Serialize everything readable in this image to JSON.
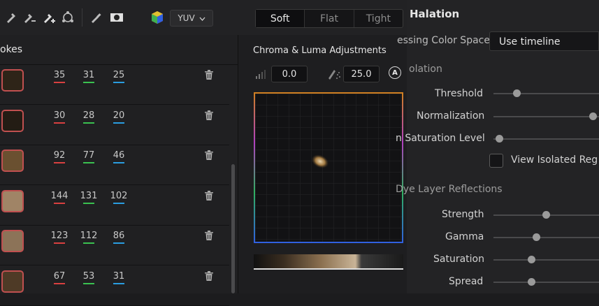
{
  "toolbar": {
    "icons": [
      "eyedropper-icon",
      "eyedropper-minus-icon",
      "eyedropper-plus-icon",
      "picker-cycle-icon",
      "brush-icon",
      "mask-toggle-icon",
      "color-cube-icon"
    ],
    "color_model": "YUV",
    "modes": [
      "Soft",
      "Flat",
      "Tight"
    ],
    "selected_mode": "Soft"
  },
  "left": {
    "title_fragment": "okes",
    "rows": [
      {
        "color": "#2e2418",
        "r": "35",
        "g": "31",
        "b": "25"
      },
      {
        "color": "#231c14",
        "r": "30",
        "g": "28",
        "b": "20"
      },
      {
        "color": "#6a5030",
        "r": "92",
        "g": "77",
        "b": "46"
      },
      {
        "color": "#a08466",
        "r": "144",
        "g": "131",
        "b": "102"
      },
      {
        "color": "#8c7358",
        "r": "123",
        "g": "112",
        "b": "86"
      },
      {
        "color": "#4e3a26",
        "r": "67",
        "g": "53",
        "b": "31"
      }
    ]
  },
  "middle": {
    "title": "Chroma & Luma Adjustments",
    "value_low": "0.0",
    "value_high": "25.0",
    "auto_label": "A"
  },
  "right": {
    "title": "Halation",
    "color_space_label": "essing Color Space",
    "color_space_value": "Use timeline",
    "isolation_label": "olation",
    "threshold_label": "Threshold",
    "normalization_label": "Normalization",
    "saturation_level_label": "n Saturation Level",
    "view_isolated_label": "View Isolated Reg",
    "dye_label": "Dye Layer Reflections",
    "strength_label": "Strength",
    "gamma_label": "Gamma",
    "saturation_label": "Saturation",
    "spread_label": "Spread",
    "levels": {
      "threshold": 0.2,
      "normalization": 0.98,
      "saturation_level": 0.02,
      "strength": 0.5,
      "gamma": 0.4,
      "saturation": 0.35,
      "spread": 0.35
    }
  },
  "colors": {
    "red": "#d84040",
    "green": "#3ac050",
    "blue": "#2a9de0"
  }
}
